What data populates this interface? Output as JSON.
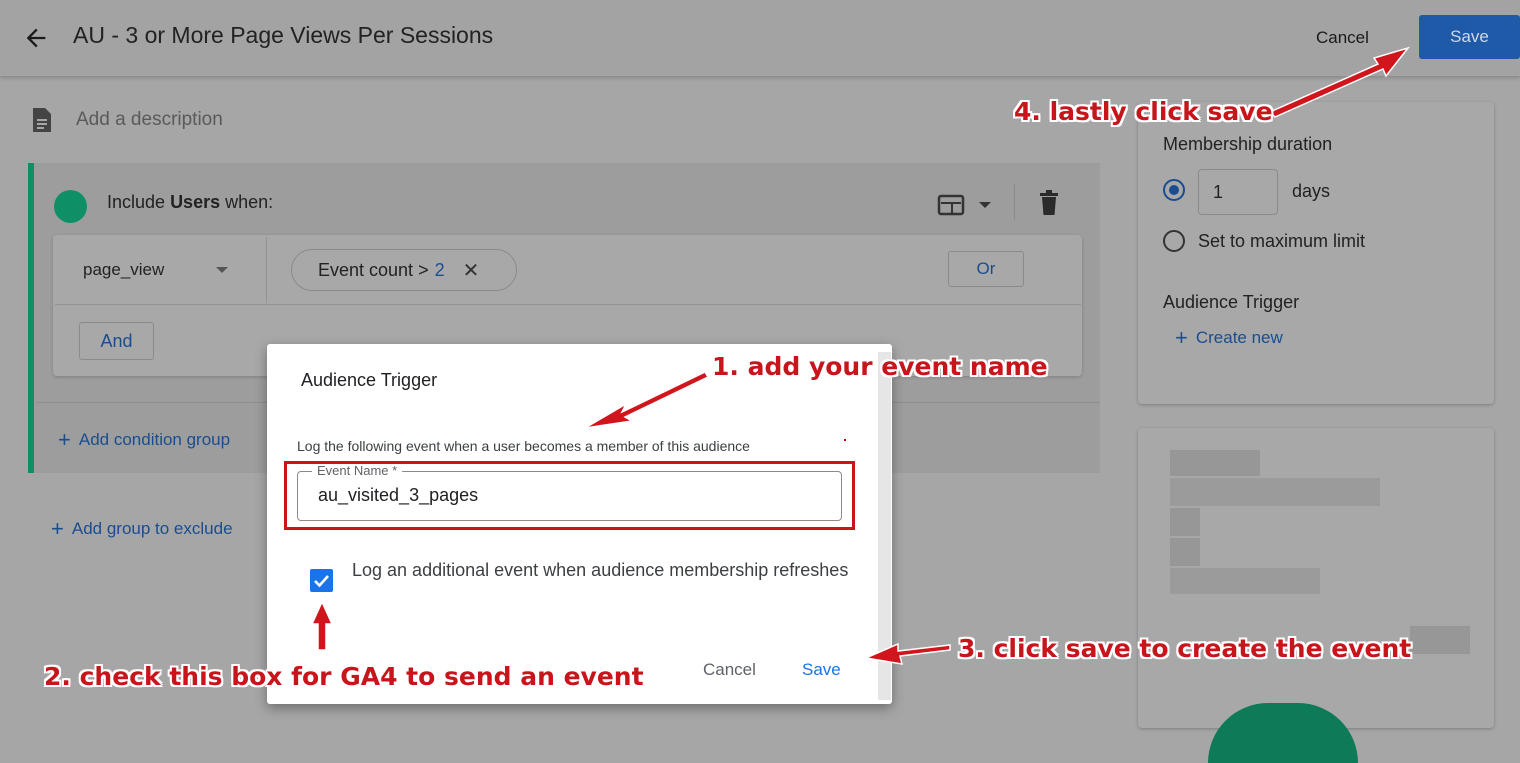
{
  "header": {
    "title": "AU - 3 or More Page Views Per Sessions",
    "cancel_label": "Cancel",
    "save_label": "Save"
  },
  "description_placeholder": "Add a description",
  "include_group": {
    "label_prefix": "Include",
    "label_bold": "Users",
    "label_suffix": "when:",
    "event_select": "page_view",
    "condition_chip": {
      "text": "Event count >",
      "value": "2"
    },
    "or_label": "Or",
    "and_label": "And",
    "add_condition_group": "Add condition group"
  },
  "add_group_to_exclude": "Add group to exclude",
  "membership": {
    "title": "Membership duration",
    "days_value": "1",
    "days_label": "days",
    "max_label": "Set to maximum limit",
    "selected_option": "days"
  },
  "audience_trigger_panel": {
    "title": "Audience Trigger",
    "create_new": "Create new"
  },
  "dialog": {
    "title": "Audience Trigger",
    "description": "Log the following event when a user becomes a member of this audience",
    "field_label": "Event Name *",
    "field_value": "au_visited_3_pages",
    "checkbox_checked": true,
    "checkbox_label": "Log an additional event when audience membership refreshes",
    "cancel_label": "Cancel",
    "save_label": "Save"
  },
  "annotations": {
    "step1": "1. add your event name",
    "step2": "2. check this box for GA4 to send an event",
    "step3": "3. click save to create the event",
    "step4": "4. lastly click save"
  },
  "colors": {
    "accent_blue": "#1a73e8",
    "annotation_red": "#c8151b",
    "group_green": "#0f8f66"
  }
}
